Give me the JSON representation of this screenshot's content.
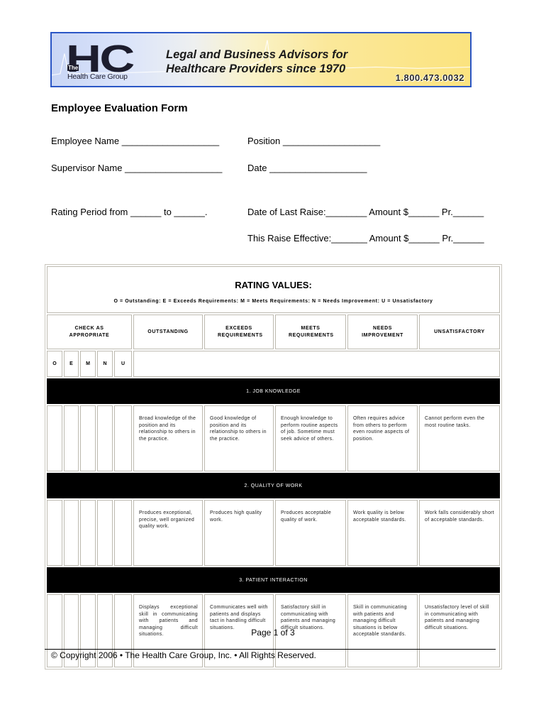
{
  "banner": {
    "logo_letters": "HC",
    "logo_the": "The",
    "logo_group": "Health Care Group",
    "tagline_line1": "Legal and Business Advisors for",
    "tagline_line2": "Healthcare Providers since 1970",
    "phone": "1.800.473.0032",
    "colors": {
      "border": "#2a56c6",
      "logo": "#1d1d2e",
      "gold": "#fbe37f",
      "blue": "#c9d6f5"
    }
  },
  "form": {
    "title": "Employee Evaluation Form",
    "employee_name": "Employee Name ___________________",
    "position": "Position ___________________",
    "supervisor_name": "Supervisor Name ___________________",
    "date": "Date ___________________",
    "rating_period": "Rating Period from ______ to ______.",
    "last_raise": "Date of Last Raise:________ Amount $______ Pr.______",
    "raise_effective": "This Raise Effective:_______ Amount $______ Pr.______"
  },
  "table": {
    "rating_title": "RATING VALUES:",
    "rating_legend": "O = Outstanding: E = Exceeds Requirements: M = Meets Requirements: N = Needs Improvement: U = Unsatisfactory",
    "headers": {
      "check": "CHECK AS APPROPRIATE",
      "outstanding": "OUTSTANDING",
      "exceeds": "EXCEEDS REQUIREMENTS",
      "meets": "MEETS REQUIREMENTS",
      "needs": "NEEDS IMPROVEMENT",
      "unsatisfactory": "UNSATISFACTORY"
    },
    "letters": [
      "O",
      "E",
      "M",
      "N",
      "U"
    ],
    "sections": [
      {
        "title": "1. JOB KNOWLEDGE",
        "descriptions": [
          "Broad knowledge of the position and its relationship to others in the practice.",
          "Good knowledge of position and its relationship to others in the practice.",
          "Enough knowledge to perform routine aspects of job. Sometime must seek advice of others.",
          "Often requires advice from others to perform even routine aspects of position.",
          "Cannot perform even the most routine tasks."
        ]
      },
      {
        "title": "2. QUALITY OF WORK",
        "descriptions": [
          "Produces exceptional, precise, well organized quality work.",
          "Produces high quality work.",
          "Produces acceptable quality of work.",
          "Work quality is below acceptable standards.",
          "Work falls considerably short of acceptable standards."
        ]
      },
      {
        "title": "3. PATIENT INTERACTION",
        "descriptions": [
          "Displays exceptional skill in communicating with patients and managing difficult situations.",
          "Communicates well with patients and displays tact in handling difficult situations.",
          "Satisfactory skill in communicating with patients and managing difficult situations.",
          "Skill in communicating with patients and managing difficult situations is below acceptable standards.",
          "Unsatisfactory level of skill in communicating with patients and managing difficult situations."
        ]
      }
    ]
  },
  "footer": {
    "page": "Page 1 of 3",
    "copyright": "© Copyright 2006 • The Health Care Group, Inc. • All Rights Reserved."
  }
}
